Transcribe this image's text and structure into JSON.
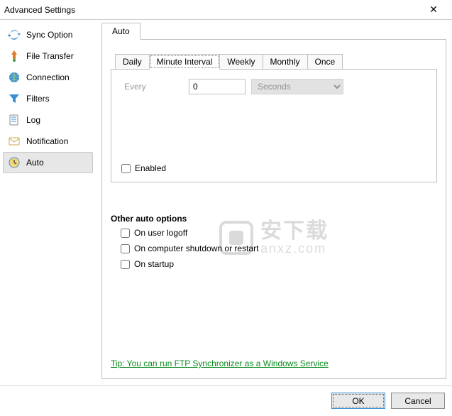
{
  "window": {
    "title": "Advanced Settings",
    "close": "✕"
  },
  "sidebar": {
    "items": [
      {
        "label": "Sync Option"
      },
      {
        "label": "File Transfer"
      },
      {
        "label": "Connection"
      },
      {
        "label": "Filters"
      },
      {
        "label": "Log"
      },
      {
        "label": "Notification"
      },
      {
        "label": "Auto"
      }
    ],
    "selected_index": 6
  },
  "outer_tab": {
    "label": "Auto"
  },
  "inner_tabs": {
    "items": [
      {
        "label": "Daily"
      },
      {
        "label": "Minute Interval"
      },
      {
        "label": "Weekly"
      },
      {
        "label": "Monthly"
      },
      {
        "label": "Once"
      }
    ],
    "selected_index": 1
  },
  "interval": {
    "every_label": "Every",
    "value": "0",
    "unit": "Seconds"
  },
  "enabled": {
    "label": "Enabled",
    "checked": false
  },
  "other": {
    "title": "Other auto options",
    "opt1": {
      "label": "On user logoff",
      "checked": false
    },
    "opt2": {
      "label": "On computer shutdown or restart",
      "checked": false
    },
    "opt3": {
      "label": "On startup",
      "checked": false
    }
  },
  "tip": "Tip: You can run FTP Synchronizer as a Windows Service",
  "buttons": {
    "ok": "OK",
    "cancel": "Cancel"
  },
  "watermark": {
    "cn": "安下载",
    "url": "anxz.com"
  }
}
